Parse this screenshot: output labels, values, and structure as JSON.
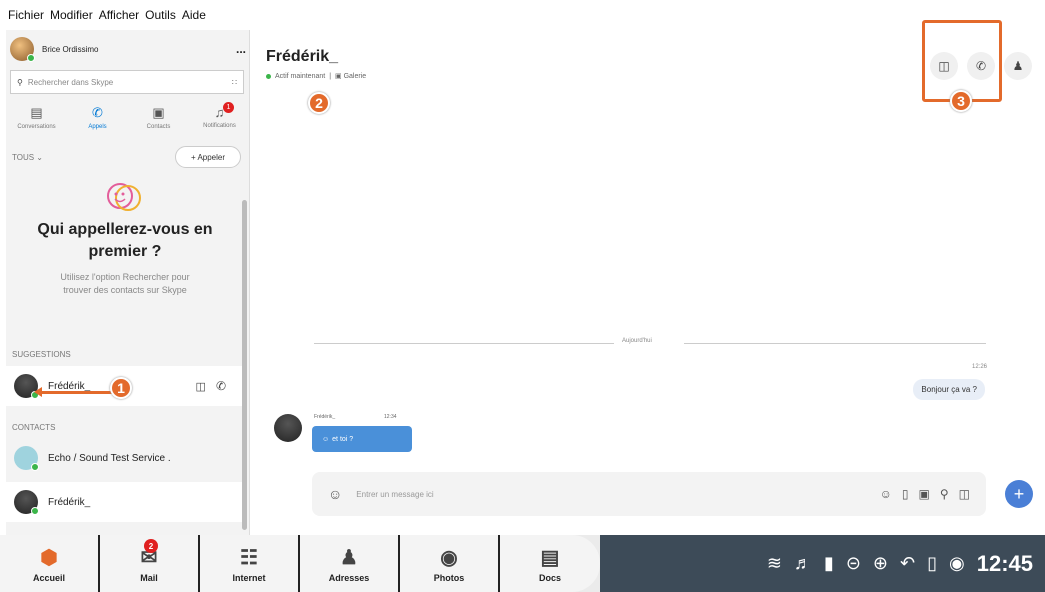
{
  "menubar": {
    "items": [
      "Fichier",
      "Modifier",
      "Afficher",
      "Outils",
      "Aide"
    ]
  },
  "sidebar": {
    "profile_name": "Brice Ordissimo",
    "more": "...",
    "search_placeholder": "Rechercher dans Skype",
    "tabs": [
      {
        "label": "Conversations",
        "icon": "chat-icon"
      },
      {
        "label": "Appels",
        "icon": "phone-icon"
      },
      {
        "label": "Contacts",
        "icon": "contacts-icon"
      },
      {
        "label": "Notifications",
        "icon": "bell-icon",
        "badge": "1"
      }
    ],
    "filter": "TOUS",
    "call_button": "+ Appeler",
    "hero_title": "Qui appellerez-vous en premier ?",
    "hero_text": "Utilisez l'option Rechercher pour trouver des contacts sur Skype",
    "suggestions_header": "SUGGESTIONS",
    "suggestion_name": "Frédérik_",
    "contacts_header": "CONTACTS",
    "contacts": [
      "Echo / Sound Test Service .",
      "Frédérik_"
    ]
  },
  "chat": {
    "name": "Frédérik_",
    "status": "Actif maintenant",
    "gallery": "Galerie",
    "divider": "Aujourd'hui",
    "out_time": "12:26",
    "out_msg": "Bonjour ça va ?",
    "in_name": "Frédérik_",
    "in_time": "12:34",
    "in_msg": "et toi ?",
    "composer_placeholder": "Entrer un message ici"
  },
  "steps": [
    "1",
    "2",
    "3"
  ],
  "taskbar": {
    "items": [
      {
        "label": "Accueil",
        "icon": "home-icon"
      },
      {
        "label": "Mail",
        "icon": "mail-icon",
        "badge": "2"
      },
      {
        "label": "Internet",
        "icon": "globe-icon"
      },
      {
        "label": "Adresses",
        "icon": "address-icon"
      },
      {
        "label": "Photos",
        "icon": "camera-icon"
      },
      {
        "label": "Docs",
        "icon": "docs-icon"
      }
    ],
    "clock": "12:45"
  },
  "colors": {
    "accent": "#0078d4",
    "highlight": "#e36a2b",
    "taskbar_dark": "#3d4b58"
  }
}
